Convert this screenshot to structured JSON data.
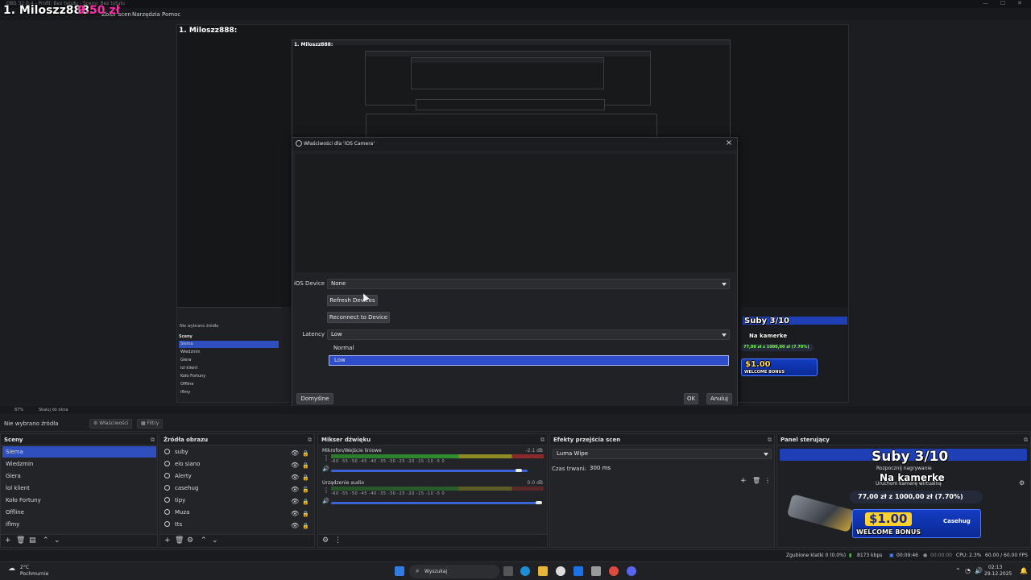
{
  "window": {
    "title": "OBS 32.0.4 - Profil: Bez tytułu - Sceny: Bez tytułu",
    "overlay_name": "1. Miloszz888:",
    "overlay_amount": "9.50 zł"
  },
  "menu": [
    "Zbiór scen",
    "Narzędzia",
    "Pomoc"
  ],
  "dialog": {
    "title": "Właściwości dla 'iOS Camera'",
    "ios_device_label": "iOS Device",
    "ios_device_value": "None",
    "refresh_button": "Refresh Devices",
    "reconnect_button": "Reconnect to Device",
    "latency_label": "Latency",
    "latency_value": "Low",
    "latency_options": [
      "Normal",
      "Low"
    ],
    "latency_selected": "Low",
    "defaults_button": "Domyślne",
    "ok_button": "OK",
    "cancel_button": "Anuluj"
  },
  "zoom": {
    "percent": "87%",
    "fit": "Skaluj do okna"
  },
  "source_toolbar": {
    "no_source": "Nie wybrano źródła",
    "properties": "Właściwości",
    "filters": "Filtry"
  },
  "scenes": {
    "title": "Sceny",
    "items": [
      "Siema",
      "Wiedzmin",
      "Giera",
      "lol klient",
      "Koło Fortuny",
      "Offline",
      "iflmy"
    ],
    "selected": "Siema"
  },
  "sources": {
    "title": "Źródła obrazu",
    "items": [
      "suby",
      "elo siano",
      "Alerty",
      "casehug",
      "tipy",
      "Muza",
      "tts"
    ]
  },
  "mixer": {
    "title": "Mikser dźwięku",
    "channels": [
      {
        "name": "Mikrofon/Wejście liniowe",
        "db": "-2.1 dB",
        "level": 0.62,
        "volume": 0.97
      },
      {
        "name": "Urządzenie audio",
        "db": "0.0 dB",
        "level": 0.0,
        "volume": 1.0
      }
    ],
    "ticks": [
      "-60",
      "-55",
      "-50",
      "-45",
      "-40",
      "-35",
      "-30",
      "-25",
      "-20",
      "-15",
      "-10",
      "-5",
      "0"
    ]
  },
  "transitions": {
    "title": "Efekty przejścia scen",
    "selected": "Luma Wipe",
    "duration_label": "Czas trwania",
    "duration_value": "300 ms"
  },
  "control_panel": {
    "title": "Panel sterujący",
    "subs": "Suby 3/10",
    "start_recording": "Rozpocznij nagrywanie",
    "on_camera": "Na kamerke",
    "virtual_cam": "Uruchom kamerę wirtualną",
    "goal": "77,00 zł z 1000,00 zł (7.70%)",
    "bonus_amount": "$1.00",
    "bonus_text": "WELCOME BONUS",
    "brand": "Casehug"
  },
  "statusbar": {
    "dropped": "Zgubione klatki 0 (0.0%)",
    "bitrate": "8173 kbps",
    "stream_time": "00:09:46",
    "rec_time": "00:00:00",
    "cpu": "CPU: 2.3%",
    "fps": "60.00 / 60.00 FPS"
  },
  "taskbar": {
    "weather_temp": "2°C",
    "weather_text": "Pochmurnie",
    "search": "Wyszukaj",
    "time": "02:13",
    "date": "29.12.2025"
  },
  "colors": {
    "accent": "#2e4fbd",
    "overlay_pink": "#ff2ba8",
    "goal_green": "#7cff4a"
  }
}
